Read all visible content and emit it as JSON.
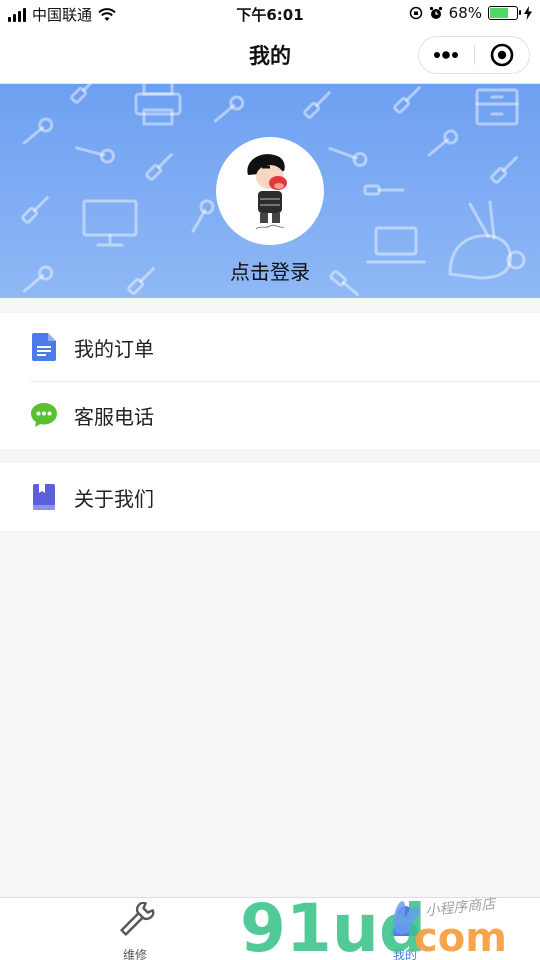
{
  "status_bar": {
    "carrier": "中国联通",
    "time": "下午6:01",
    "battery": "68%",
    "battery_level": 0.68
  },
  "navbar": {
    "title": "我的"
  },
  "profile": {
    "login_text": "点击登录"
  },
  "menu": {
    "group1": [
      {
        "label": "我的订单",
        "icon": "document-icon",
        "color": "#4a7be8"
      },
      {
        "label": "客服电话",
        "icon": "chat-bubble-icon",
        "color": "#59c12e"
      }
    ],
    "group2": [
      {
        "label": "关于我们",
        "icon": "book-icon",
        "color": "#5b5fdc"
      }
    ]
  },
  "tabbar": {
    "tabs": [
      {
        "label": "维修",
        "icon": "wrench-icon"
      },
      {
        "label": "我的",
        "icon": "user-icon"
      }
    ]
  },
  "watermark": {
    "brand": "91ud",
    "suffix": "com",
    "tagline": "小程序商店"
  },
  "colors": {
    "accent": "#4a7be8",
    "banner_top": "#6ea0f2",
    "banner_bottom": "#8fb8f5",
    "watermark_green": "#3ec48c",
    "watermark_orange": "#f5a043"
  }
}
